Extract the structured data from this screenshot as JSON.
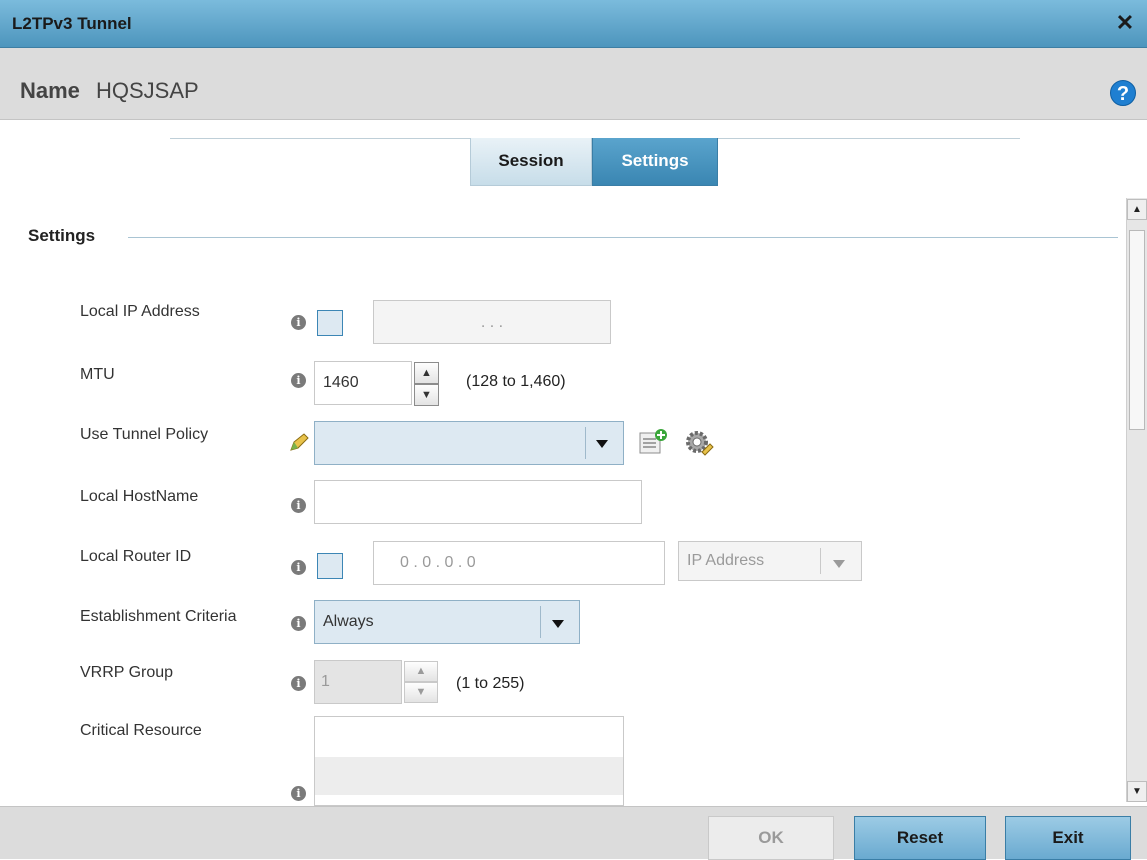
{
  "window": {
    "title": "L2TPv3 Tunnel",
    "close_glyph": "✕"
  },
  "header": {
    "name_label": "Name",
    "name_value": "HQSJSAP",
    "help_glyph": "?"
  },
  "tabs": [
    {
      "label": "Session",
      "active": false
    },
    {
      "label": "Settings",
      "active": true
    }
  ],
  "section": {
    "title": "Settings"
  },
  "form": {
    "local_ip": {
      "label": "Local IP Address",
      "value": ".      .      ."
    },
    "mtu": {
      "label": "MTU",
      "value": "1460",
      "range": "(128 to 1,460)"
    },
    "tunnel_policy": {
      "label": "Use Tunnel Policy",
      "value": ""
    },
    "local_hostname": {
      "label": "Local HostName",
      "value": ""
    },
    "local_router_id": {
      "label": "Local Router ID",
      "value": "0  .  0  .  0  .  0",
      "type_value": "IP Address"
    },
    "establishment": {
      "label": "Establishment Criteria",
      "value": "Always"
    },
    "vrrp_group": {
      "label": "VRRP Group",
      "value": "1",
      "range": "(1 to 255)"
    },
    "critical_resource": {
      "label": "Critical Resource"
    }
  },
  "icons": {
    "info": "info-icon",
    "edit": "pencil-icon",
    "add": "add-policy-icon",
    "settings": "gear-icon"
  },
  "footer": {
    "ok_label": "OK",
    "reset_label": "Reset",
    "exit_label": "Exit"
  },
  "colors": {
    "accent": "#4d95bd",
    "header_bg": "#dcdcdc",
    "help": "#1f7fd1"
  }
}
